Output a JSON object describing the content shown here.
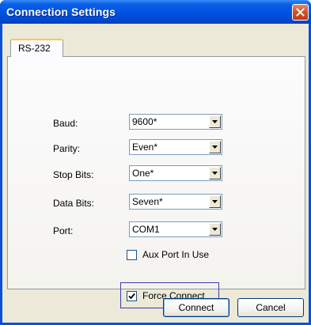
{
  "window": {
    "title": "Connection Settings"
  },
  "tabs": [
    {
      "label": "RS-232"
    }
  ],
  "fields": [
    {
      "label": "Baud:",
      "value": "9600*"
    },
    {
      "label": "Parity:",
      "value": "Even*"
    },
    {
      "label": "Stop Bits:",
      "value": "One*"
    },
    {
      "label": "Data Bits:",
      "value": "Seven*"
    },
    {
      "label": "Port:",
      "value": "COM1"
    }
  ],
  "checkboxes": {
    "aux_port": {
      "label": "Aux Port In Use",
      "checked": false
    },
    "force_connect": {
      "label": "Force Connect",
      "checked": true
    }
  },
  "buttons": {
    "connect": "Connect",
    "cancel": "Cancel"
  },
  "icons": {
    "close": "close-icon",
    "dropdown": "chevron-down-icon",
    "check": "check-icon"
  }
}
